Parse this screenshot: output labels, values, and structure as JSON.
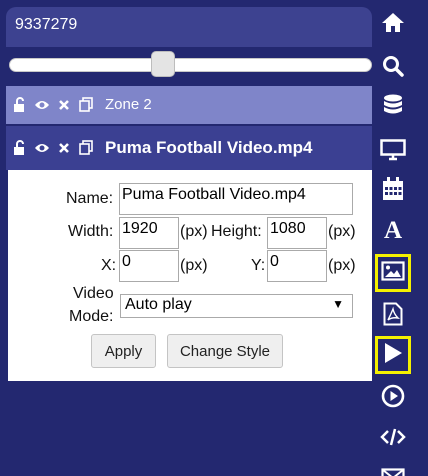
{
  "header": {
    "title": "9337279"
  },
  "slider": {
    "value_percent": 42
  },
  "zone_row": {
    "label": "Zone 2"
  },
  "file_row": {
    "label": "Puma Football Video.mp4"
  },
  "form": {
    "name_label": "Name:",
    "name_value": "Puma Football Video.mp4",
    "width_label": "Width:",
    "width_value": "1920",
    "height_label": "Height:",
    "height_value": "1080",
    "x_label": "X:",
    "x_value": "0",
    "y_label": "Y:",
    "y_value": "0",
    "px_unit": "(px)",
    "video_label_1": "Video",
    "video_label_2": "Mode:",
    "video_mode_value": "Auto play",
    "apply_label": "Apply",
    "change_style_label": "Change Style"
  },
  "toolbar": {
    "items": [
      "home-icon",
      "search-icon",
      "database-icon",
      "monitor-icon",
      "calendar-icon",
      "text-icon",
      "image-icon",
      "pdf-icon",
      "video-play-icon",
      "play-circle-icon",
      "code-icon",
      "mail-icon"
    ],
    "highlighted": [
      "image-icon",
      "video-play-icon"
    ],
    "highlight_color": "#f4f000"
  },
  "colors": {
    "background": "#232870",
    "zone_row": "#7f85c9",
    "file_row": "#3b4092"
  }
}
